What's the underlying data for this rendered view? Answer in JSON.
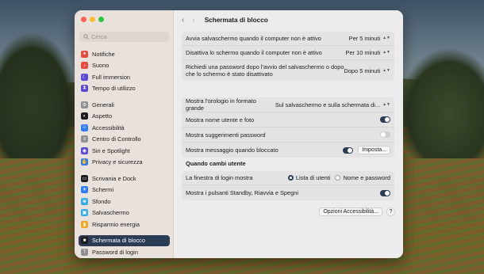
{
  "window": {
    "title": "Schermata di blocco"
  },
  "search": {
    "placeholder": "Cerca"
  },
  "sidebar": {
    "items": [
      {
        "label": "Notifiche",
        "color": "#e84a3d",
        "icon": "bell-icon"
      },
      {
        "label": "Suono",
        "color": "#e84a3d",
        "icon": "speaker-icon"
      },
      {
        "label": "Full immersion",
        "color": "#5b4ad6",
        "icon": "moon-icon"
      },
      {
        "label": "Tempo di utilizzo",
        "color": "#5b4ad6",
        "icon": "hourglass-icon"
      },
      {
        "label": "Generali",
        "color": "#8e8e93",
        "icon": "gear-icon"
      },
      {
        "label": "Aspetto",
        "color": "#1d1d1f",
        "icon": "appearance-icon"
      },
      {
        "label": "Accessibilità",
        "color": "#2f7cf6",
        "icon": "accessibility-icon"
      },
      {
        "label": "Centro di Controllo",
        "color": "#8e8e93",
        "icon": "control-center-icon"
      },
      {
        "label": "Siri e Spotlight",
        "color": "#5b4ad6",
        "icon": "siri-icon"
      },
      {
        "label": "Privacy e sicurezza",
        "color": "#2f7cf6",
        "icon": "hand-icon"
      },
      {
        "label": "Scrivania e Dock",
        "color": "#1d1d1f",
        "icon": "dock-icon"
      },
      {
        "label": "Schermi",
        "color": "#2f7cf6",
        "icon": "display-icon"
      },
      {
        "label": "Sfondo",
        "color": "#32ade6",
        "icon": "wallpaper-icon"
      },
      {
        "label": "Salvaschermo",
        "color": "#32ade6",
        "icon": "screensaver-icon"
      },
      {
        "label": "Risparmio energia",
        "color": "#f5a623",
        "icon": "battery-icon"
      },
      {
        "label": "Schermata di blocco",
        "color": "#1d1d1f",
        "icon": "lock-icon"
      },
      {
        "label": "Password di login",
        "color": "#8e8e93",
        "icon": "key-icon"
      }
    ]
  },
  "group1": {
    "rows": [
      {
        "label": "Avvia salvaschermo quando il computer non è attivo",
        "value": "Per 5 minuti"
      },
      {
        "label": "Disattiva lo schermo quando il computer non è attivo",
        "value": "Per 10 minuti"
      },
      {
        "label": "Richiedi una password dopo l'avvio del salvaschermo o dopo che lo schermo è stato disattivato",
        "value": "Dopo 5 minuti"
      }
    ]
  },
  "group2": {
    "clock_label": "Mostra l'orologio in formato grande",
    "clock_value": "Sul salvaschermo e sulla schermata di...",
    "username_label": "Mostra nome utente e foto",
    "username_on": true,
    "hints_label": "Mostra suggerimenti password",
    "hints_on": false,
    "message_label": "Mostra messaggio quando bloccato",
    "message_on": true,
    "message_button": "Imposta..."
  },
  "section": {
    "title": "Quando cambi utente"
  },
  "group3": {
    "login_label": "La finestra di login mostra",
    "option1": "Lista di utenti",
    "option2": "Nome e password",
    "selected": "option1",
    "buttons_label": "Mostra i pulsanti Standby, Riavvia e Spegni",
    "buttons_on": true
  },
  "footer": {
    "accessibility_button": "Opzioni Accessibilità...",
    "help": "?"
  }
}
